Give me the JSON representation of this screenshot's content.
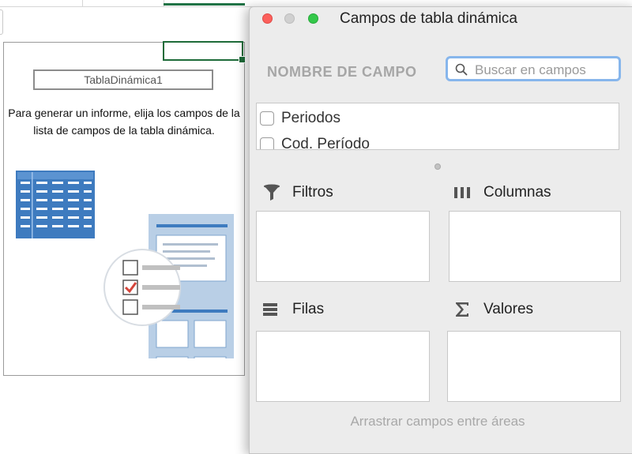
{
  "sheet": {
    "pivot_table_name": "TablaDinámica1",
    "pivot_message": "Para generar un informe, elija los campos de la lista de campos de la tabla dinámica."
  },
  "panel": {
    "title": "Campos de tabla dinámica",
    "field_name_header": "NOMBRE DE CAMPO",
    "search": {
      "placeholder": "Buscar en campos",
      "value": ""
    },
    "fields": [
      {
        "label": "Periodos",
        "checked": false
      },
      {
        "label": "Cod. Período",
        "checked": false
      }
    ],
    "areas": {
      "filters": {
        "label": "Filtros",
        "icon": "filter-icon"
      },
      "columns": {
        "label": "Columnas",
        "icon": "columns-icon"
      },
      "rows": {
        "label": "Filas",
        "icon": "rows-icon"
      },
      "values": {
        "label": "Valores",
        "icon": "sigma-icon"
      }
    },
    "footer_hint": "Arrastrar campos entre áreas"
  },
  "colors": {
    "selection_green": "#1e6b39",
    "close": "#fc605c",
    "zoom": "#34c84a",
    "search_focus": "#87b6ec",
    "illustration_blue": "#3e7bbf"
  }
}
